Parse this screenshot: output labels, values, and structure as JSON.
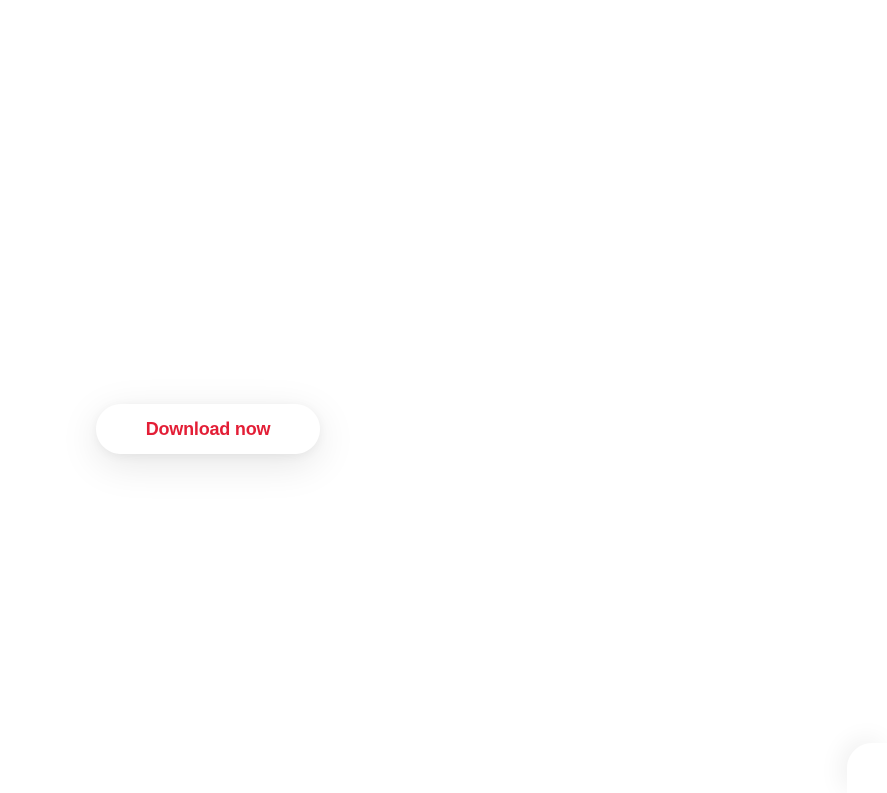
{
  "cta": {
    "download_label": "Download now"
  },
  "colors": {
    "accent": "#e31e36",
    "background": "#ffffff"
  }
}
